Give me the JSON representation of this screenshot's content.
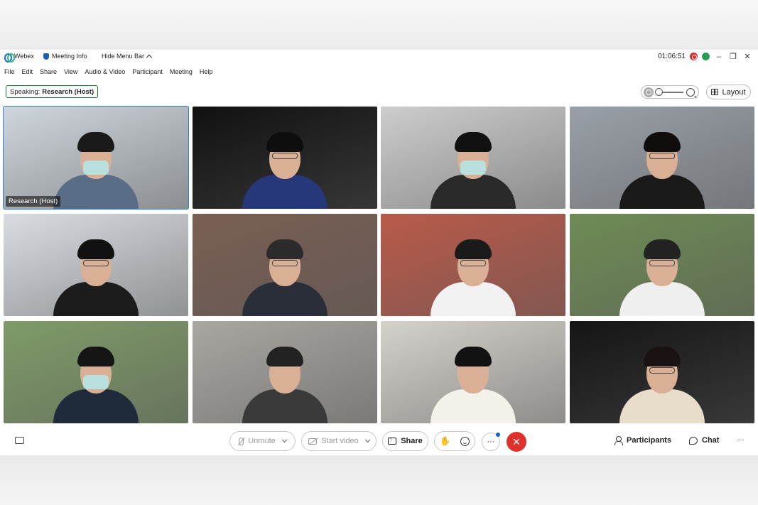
{
  "titlebar": {
    "app_name": "Webex",
    "meeting_info": "Meeting Info",
    "hide_menu": "Hide Menu Bar",
    "time": "01:06:51",
    "minimize": "–",
    "restore": "❐",
    "close": "✕"
  },
  "menu": [
    "File",
    "Edit",
    "Share",
    "View",
    "Audio & Video",
    "Participant",
    "Meeting",
    "Help"
  ],
  "speaking": {
    "prefix": "Speaking:",
    "name": "Research (Host)"
  },
  "layout_label": "Layout",
  "tiles": [
    {
      "label": "Research (Host)",
      "bg": "#cfd6dc",
      "shirt": "#5a6d86",
      "mask": true,
      "glasses": false,
      "hair": "#1a1a1a"
    },
    {
      "label": "",
      "bg": "#111111",
      "shirt": "#26377a",
      "mask": false,
      "glasses": true,
      "hair": "#0e0e0e"
    },
    {
      "label": "",
      "bg": "#cdcdcd",
      "shirt": "#2a2a2a",
      "mask": true,
      "glasses": false,
      "hair": "#111111"
    },
    {
      "label": "",
      "bg": "#9aa0a8",
      "shirt": "#1a1a1a",
      "mask": false,
      "glasses": true,
      "hair": "#120d0d"
    },
    {
      "label": "",
      "bg": "#d9dde2",
      "shirt": "#1c1c1c",
      "mask": false,
      "glasses": true,
      "hair": "#111111"
    },
    {
      "label": "",
      "bg": "#7a5f53",
      "shirt": "#2a2e38",
      "mask": false,
      "glasses": true,
      "hair": "#2b2b2b"
    },
    {
      "label": "",
      "bg": "#b95a4a",
      "shirt": "#f2f2f2",
      "mask": false,
      "glasses": true,
      "hair": "#1a1a1a"
    },
    {
      "label": "",
      "bg": "#6f8b55",
      "shirt": "#efefef",
      "mask": false,
      "glasses": true,
      "hair": "#222222"
    },
    {
      "label": "",
      "bg": "#7f9b68",
      "shirt": "#1f2a3a",
      "mask": true,
      "glasses": false,
      "hair": "#151515"
    },
    {
      "label": "",
      "bg": "#a9a7a2",
      "shirt": "#3a3a3a",
      "mask": false,
      "glasses": false,
      "hair": "#222222"
    },
    {
      "label": "",
      "bg": "#d5d2cc",
      "shirt": "#f4f1ea",
      "mask": false,
      "glasses": false,
      "hair": "#121212"
    },
    {
      "label": "",
      "bg": "#151515",
      "shirt": "#e8dccb",
      "mask": false,
      "glasses": true,
      "hair": "#1a1212"
    }
  ],
  "toolbar": {
    "unmute": "Unmute",
    "start_video": "Start video",
    "share": "Share",
    "hand": "✋",
    "more": "···",
    "end": "✕",
    "participants": "Participants",
    "chat": "Chat",
    "overflow": "···"
  },
  "colors": {
    "accent": "#2f7fd6",
    "end_call": "#e0312c",
    "speaking_border": "#1a6e3a"
  }
}
